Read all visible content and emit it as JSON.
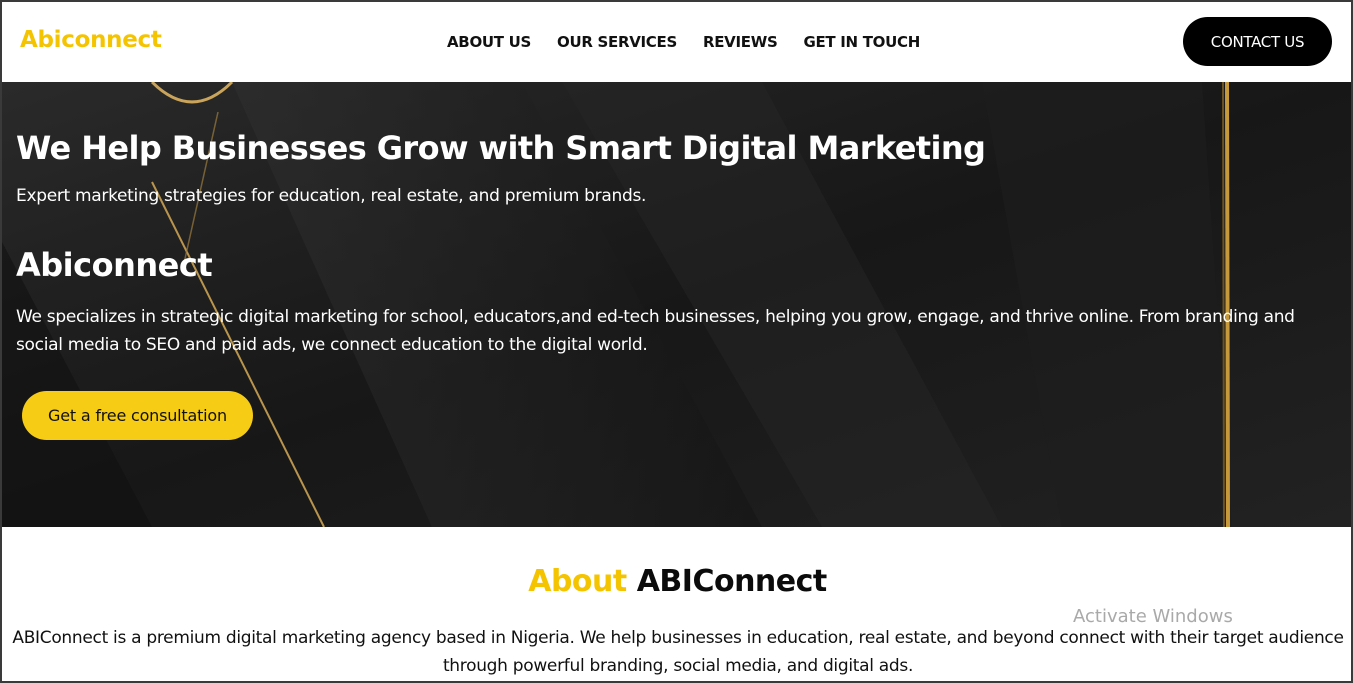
{
  "nav": {
    "logo": "Abiconnect",
    "menu": [
      "ABOUT US",
      "OUR SERVICES",
      "REVIEWS",
      "GET IN TOUCH"
    ],
    "contact_label": "CONTACT US"
  },
  "hero": {
    "title": "We Help Businesses Grow with Smart Digital Marketing",
    "subtitle": "Expert marketing strategies for education, real estate, and premium brands.",
    "brand": "Abiconnect",
    "description": "We specializes in strategic digital marketing for school, educators,and ed-tech businesses, helping you grow, engage, and thrive online. From branding and social media to SEO and paid ads, we connect education to the digital world.",
    "cta_label": "Get a free consultation"
  },
  "about": {
    "title_accent": "About",
    "title_main": "ABIConnect",
    "text": "ABIConnect is a premium digital marketing agency based in Nigeria. We help businesses in education, real estate, and beyond connect with their target audience through powerful branding, social media, and digital ads."
  },
  "watermark": "Activate Windows",
  "colors": {
    "accent": "#f5c400",
    "button_yellow": "#f7cc14",
    "hero_bg": "#1b1b1b",
    "gold_line": "#c9a45a"
  }
}
